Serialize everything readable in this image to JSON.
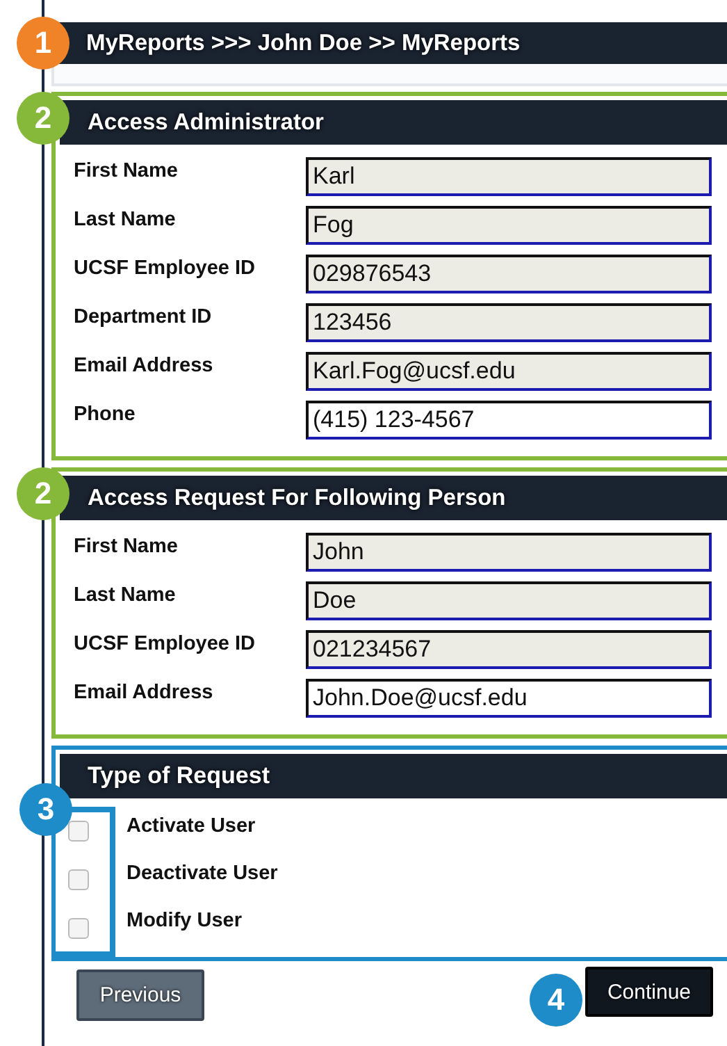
{
  "breadcrumb": {
    "marker": {
      "number": "1",
      "color": "#f08228"
    },
    "text": "MyReports >>> John Doe >> MyReports"
  },
  "sections": [
    {
      "marker": {
        "number": "2",
        "color": "#86b83a"
      },
      "title": "Access Administrator",
      "fields": [
        {
          "label": "First Name",
          "value": "Karl",
          "readonly": true
        },
        {
          "label": "Last Name",
          "value": "Fog",
          "readonly": true
        },
        {
          "label": "UCSF Employee ID",
          "value": "029876543",
          "readonly": true
        },
        {
          "label": "Department ID",
          "value": "123456",
          "readonly": true
        },
        {
          "label": "Email Address",
          "value": "Karl.Fog@ucsf.edu",
          "readonly": true
        },
        {
          "label": "Phone",
          "value": "(415) 123-4567",
          "readonly": false
        }
      ]
    },
    {
      "marker": {
        "number": "2",
        "color": "#86b83a"
      },
      "title": "Access Request For Following Person",
      "fields": [
        {
          "label": "First Name",
          "value": "John",
          "readonly": true
        },
        {
          "label": "Last Name",
          "value": "Doe",
          "readonly": true
        },
        {
          "label": "UCSF Employee ID",
          "value": "021234567",
          "readonly": true
        },
        {
          "label": "Email Address",
          "value": "John.Doe@ucsf.edu",
          "readonly": false
        }
      ]
    }
  ],
  "request_type": {
    "marker": {
      "number": "3",
      "color": "#1e8cc8"
    },
    "title": "Type of Request",
    "options": [
      {
        "label": "Activate User",
        "checked": false
      },
      {
        "label": "Deactivate User",
        "checked": false
      },
      {
        "label": "Modify User",
        "checked": false
      }
    ]
  },
  "buttons": [
    {
      "label": "Previous",
      "kind": "secondary"
    },
    {
      "label": "Continue",
      "kind": "primary",
      "marker": {
        "number": "4",
        "color": "#1e8cc8"
      }
    }
  ]
}
